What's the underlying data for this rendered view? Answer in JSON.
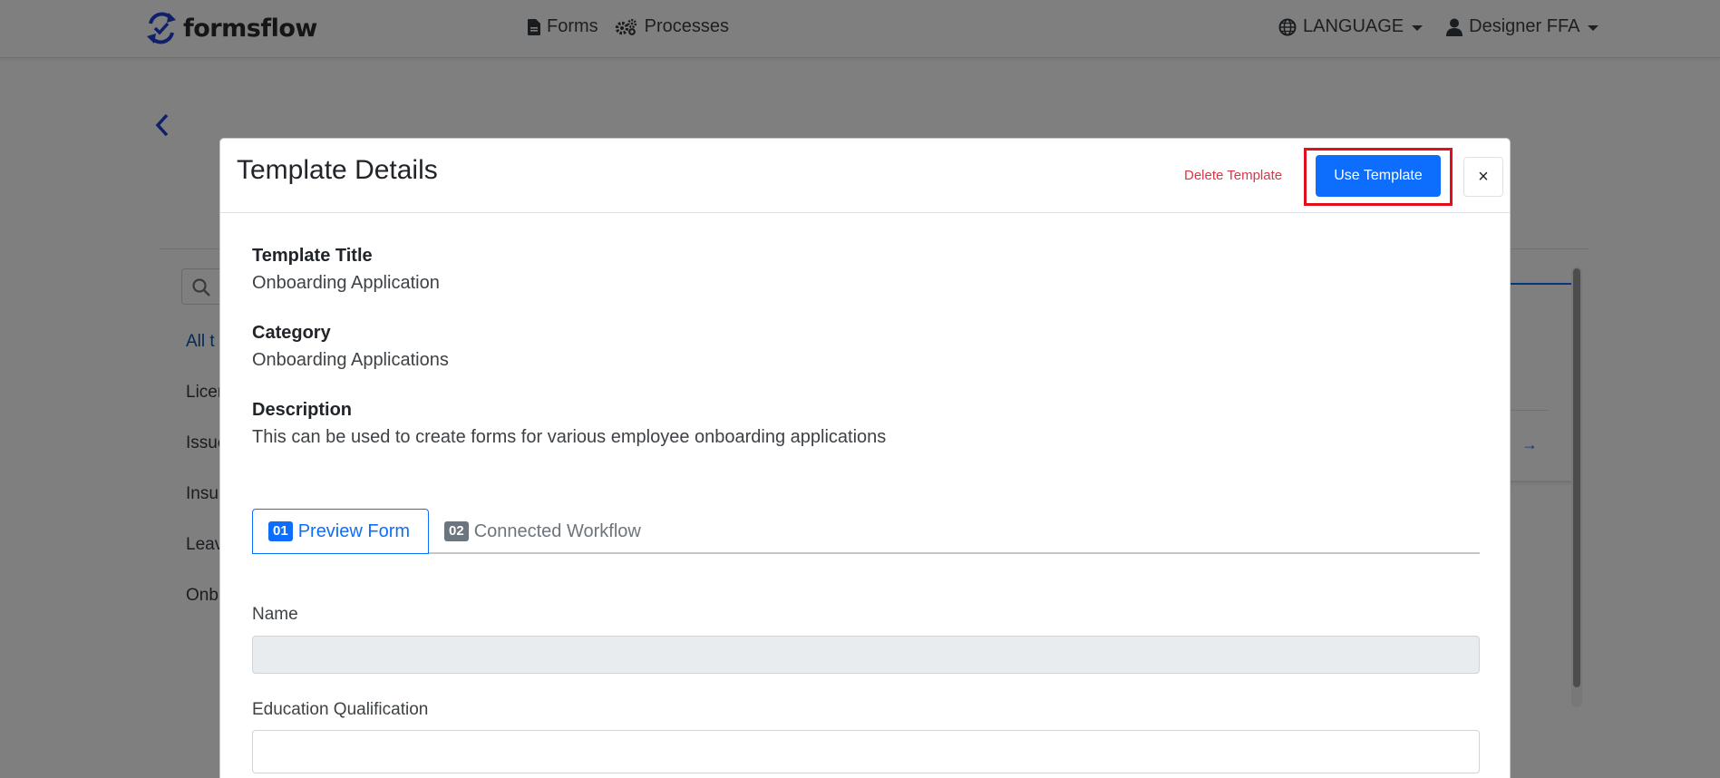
{
  "navbar": {
    "brand": "formsflow",
    "links": [
      {
        "label": "Forms",
        "icon": "file-icon"
      },
      {
        "label": "Processes",
        "icon": "gears-icon"
      }
    ],
    "language_label": "LANGUAGE",
    "user_label": "Designer FFA"
  },
  "background": {
    "categories": [
      "All t",
      "Licen",
      "Issue",
      "Insu",
      "Leav",
      "Onb"
    ]
  },
  "modal": {
    "title": "Template Details",
    "delete_label": "Delete Template",
    "use_label": "Use Template",
    "close_label": "×",
    "fields": [
      {
        "label": "Template Title",
        "value": "Onboarding Application"
      },
      {
        "label": "Category",
        "value": "Onboarding Applications"
      },
      {
        "label": "Description",
        "value": "This can be used to create forms for various employee onboarding applications"
      }
    ],
    "tabs": [
      {
        "badge": "01",
        "label": "Preview Form"
      },
      {
        "badge": "02",
        "label": "Connected Workflow"
      }
    ],
    "form": {
      "name_label": "Name",
      "education_label": "Education Qualification"
    }
  },
  "colors": {
    "primary": "#0d6efd",
    "danger": "#dc3545",
    "highlight": "#e0101c",
    "brand_icon": "#1f3fd1"
  }
}
